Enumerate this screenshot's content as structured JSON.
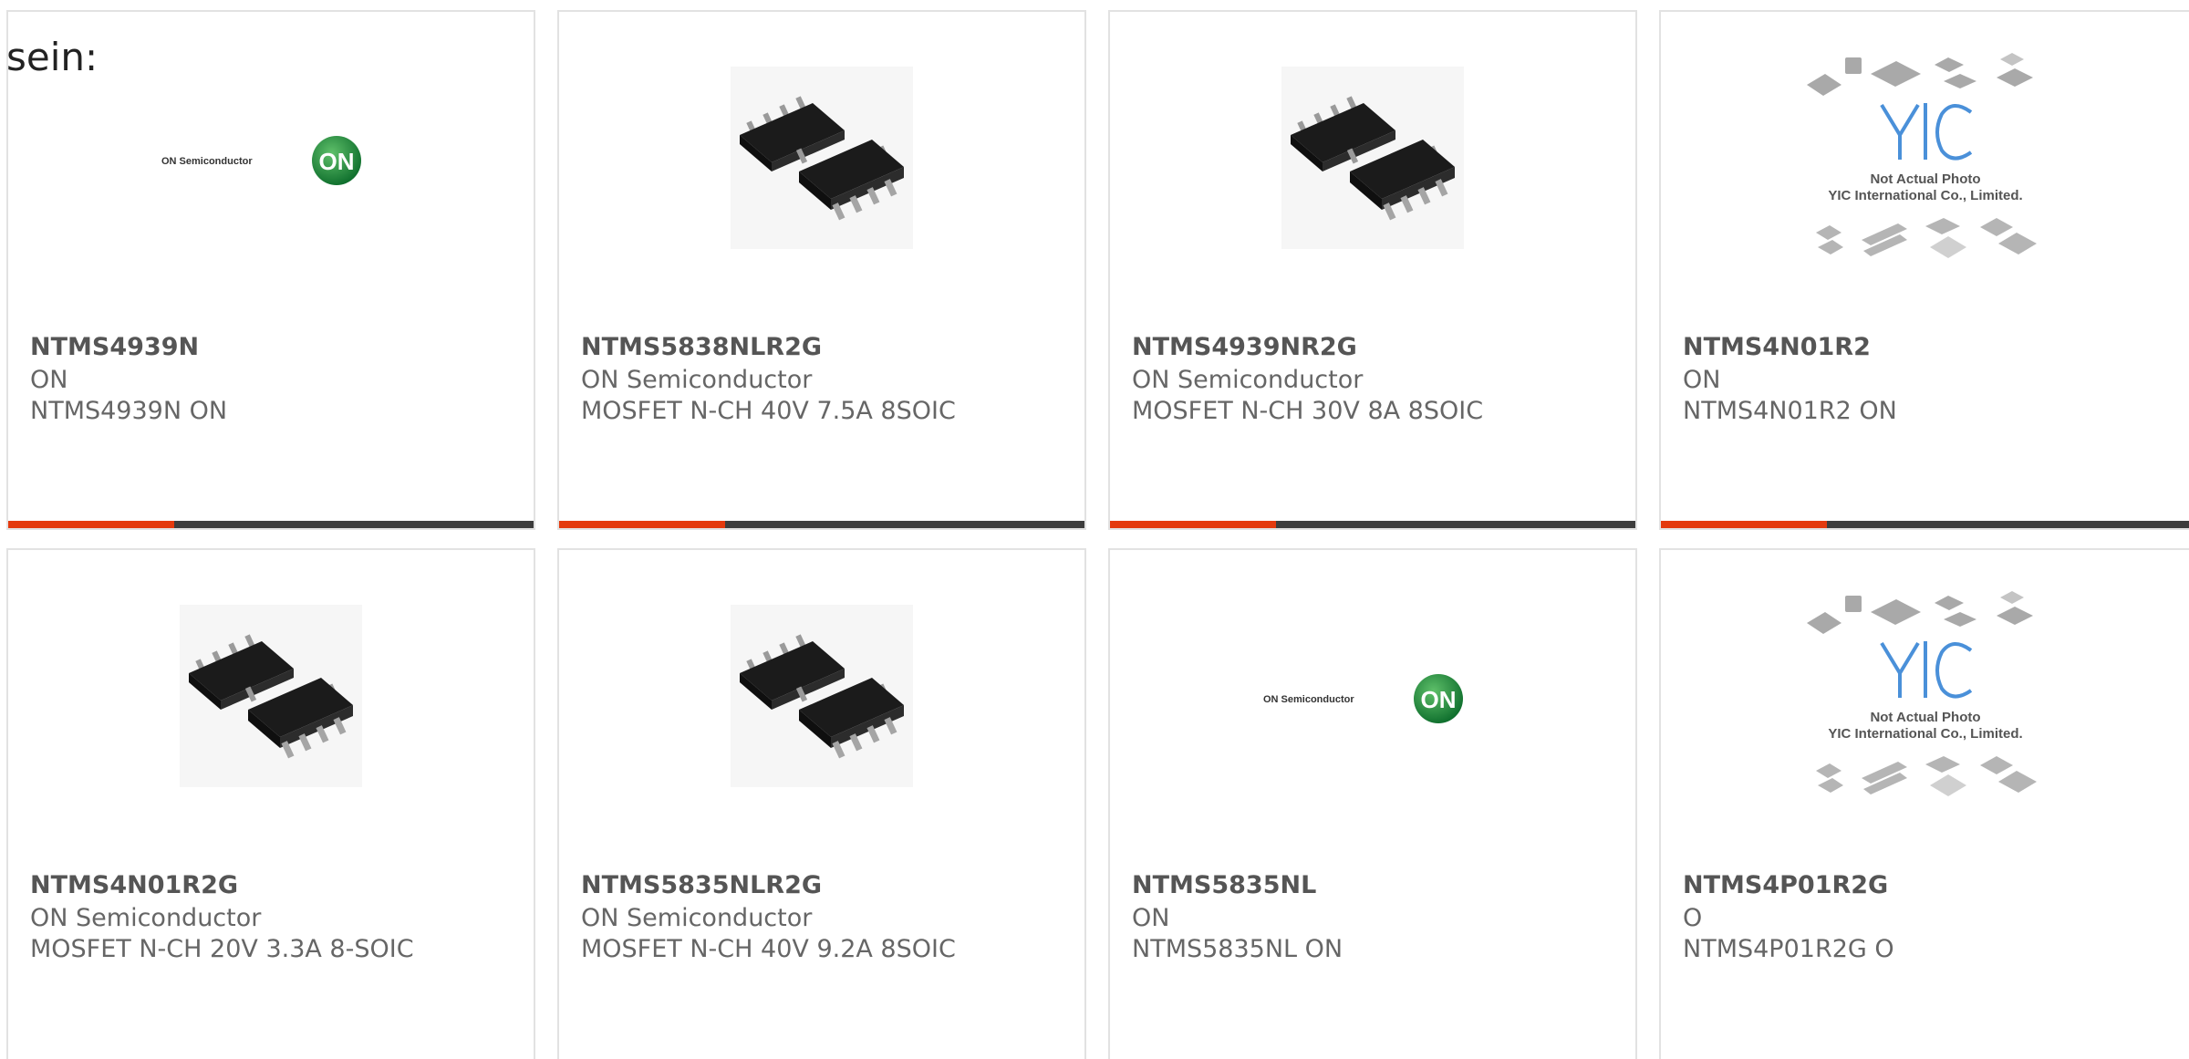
{
  "intro_text": "sein:",
  "colors": {
    "accent": "#e43a0e",
    "bar": "#3d3d3d",
    "card_border": "#e2e2e2"
  },
  "products": [
    {
      "part_number": "NTMS4939N",
      "manufacturer": "ON",
      "description": "NTMS4939N ON",
      "image": "on-semiconductor-logo"
    },
    {
      "part_number": "NTMS5838NLR2G",
      "manufacturer": "ON Semiconductor",
      "description": "MOSFET N-CH 40V 7.5A 8SOIC",
      "image": "soic8-chip-photo"
    },
    {
      "part_number": "NTMS4939NR2G",
      "manufacturer": "ON Semiconductor",
      "description": "MOSFET N-CH 30V 8A 8SOIC",
      "image": "soic8-chip-photo"
    },
    {
      "part_number": "NTMS4N01R2",
      "manufacturer": "ON",
      "description": "NTMS4N01R2 ON",
      "image": "yic-not-actual-photo"
    },
    {
      "part_number": "NTMS4N01R2G",
      "manufacturer": "ON Semiconductor",
      "description": "MOSFET N-CH 20V 3.3A 8-SOIC",
      "image": "soic8-chip-photo"
    },
    {
      "part_number": "NTMS5835NLR2G",
      "manufacturer": "ON Semiconductor",
      "description": "MOSFET N-CH 40V 9.2A 8SOIC",
      "image": "soic8-chip-photo"
    },
    {
      "part_number": "NTMS5835NL",
      "manufacturer": "ON",
      "description": "NTMS5835NL ON",
      "image": "on-semiconductor-logo"
    },
    {
      "part_number": "NTMS4P01R2G",
      "manufacturer": "O",
      "description": "NTMS4P01R2G O",
      "image": "yic-not-actual-photo"
    }
  ],
  "logo_text": {
    "on_semiconductor": "ON Semiconductor",
    "on_badge": "ON"
  },
  "yic_text": {
    "line1": "Not Actual Photo",
    "line2": "YIC International Co., Limited.",
    "mark": "YIC"
  }
}
